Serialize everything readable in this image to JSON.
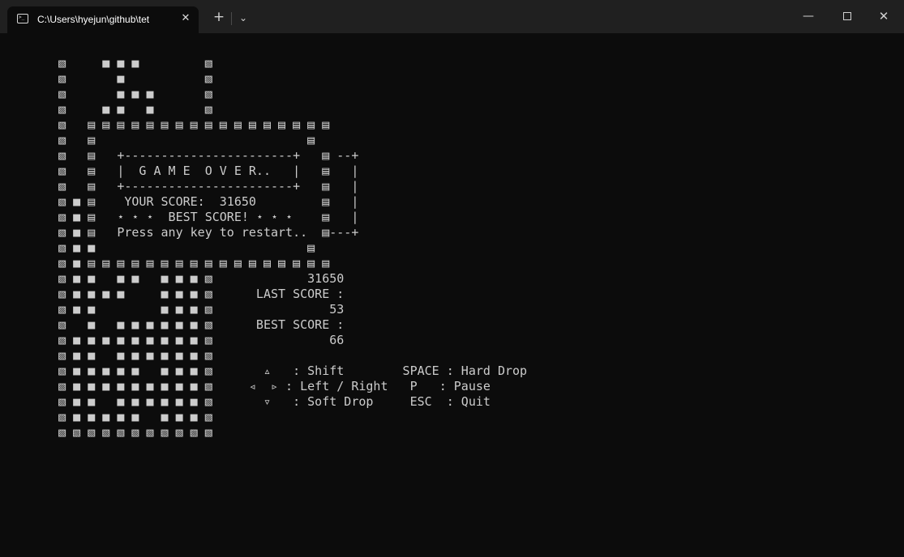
{
  "window": {
    "tab_title": "C:\\Users\\hyejun\\github\\tet",
    "tab_icon": "terminal-icon",
    "new_tab_glyph": "+",
    "dropdown_glyph": "⌄",
    "close_tab_glyph": "✕",
    "minimize_glyph": "—",
    "close_glyph": "✕"
  },
  "terminal": {
    "lines": [
      "   ▧     ■ ■ ■         ▧",
      "   ▧       ■           ▧",
      "   ▧       ■ ■ ■       ▧",
      "   ▧     ■ ■   ■       ▧",
      "   ▧   ▤ ▤ ▤ ▤ ▤ ▤ ▤ ▤ ▤ ▤ ▤ ▤ ▤ ▤ ▤ ▤ ▤",
      "   ▧   ▤                             ▤",
      "   ▧   ▤   +-----------------------+   ▤ --+",
      "   ▧   ▤   |  G A M E  O V E R..   |   ▤   |",
      "   ▧   ▤   +-----------------------+   ▤   |",
      "   ▧ ■ ▤    YOUR SCORE:  31650         ▤   |",
      "   ▧ ■ ▤   ⋆ ⋆ ⋆  BEST SCORE! ⋆ ⋆ ⋆    ▤   |",
      "   ▧ ■ ▤   Press any key to restart..  ▤---+",
      "   ▧ ■ ■                             ▤",
      "   ▧ ■ ▤ ▤ ▤ ▤ ▤ ▤ ▤ ▤ ▤ ▤ ▤ ▤ ▤ ▤ ▤ ▤ ▤",
      "   ▧ ■ ■   ■ ■   ■ ■ ■ ▧             31650",
      "   ▧ ■ ■ ■ ■     ■ ■ ■ ▧      LAST SCORE :",
      "   ▧ ■ ■         ■ ■ ■ ▧                53",
      "   ▧   ■   ■ ■ ■ ■ ■ ■ ▧      BEST SCORE :",
      "   ▧ ■ ■ ■ ■ ■ ■ ■ ■ ■ ▧                66",
      "   ▧ ■ ■   ■ ■ ■ ■ ■ ■ ▧",
      "   ▧ ■ ■ ■ ■ ■   ■ ■ ■ ▧       ▵   : Shift        SPACE : Hard Drop",
      "   ▧ ■ ■ ■ ■ ■ ■ ■ ■ ■ ▧     ◃  ▹ : Left / Right   P   : Pause",
      "   ▧ ■ ■   ■ ■ ■ ■ ■ ■ ▧       ▿   : Soft Drop     ESC  : Quit",
      "   ▧ ■ ■ ■ ■ ■   ■ ■ ■ ▧",
      "   ▧ ▧ ▧ ▧ ▧ ▧ ▧ ▧ ▧ ▧ ▧"
    ]
  },
  "colors": {
    "terminal_bg": "#0c0c0c",
    "terminal_fg": "#cccccc",
    "titlebar_bg": "#202020"
  }
}
